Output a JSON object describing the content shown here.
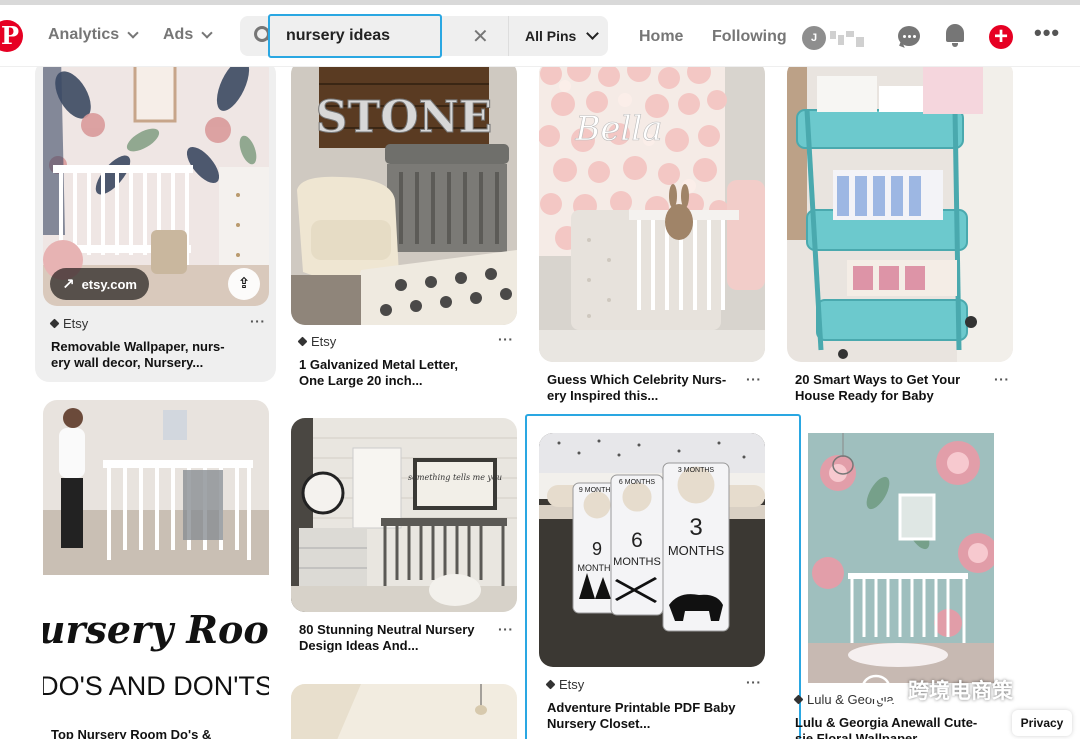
{
  "header": {
    "logo_letter": "P",
    "analytics_label": "Analytics",
    "ads_label": "Ads",
    "search": {
      "value": "nursery ideas",
      "placeholder": "Search"
    },
    "scope_label": "All Pins",
    "home_label": "Home",
    "following_label": "Following",
    "avatar_initial": "J",
    "brand_color": "#e60023"
  },
  "pins": [
    {
      "source": "Etsy",
      "title": "Removable Wallpaper, nurs-\nery wall decor, Nursery...",
      "chip": "etsy.com"
    },
    {
      "source": "Etsy",
      "title": "1 Galvanized Metal Letter,\nOne Large 20 inch...",
      "sign_text": "STONE"
    },
    {
      "title": "Guess Which Celebrity Nurs-\nery Inspired this...",
      "sign_text": "Bella"
    },
    {
      "title": "20 Smart Ways to Get Your\nHouse Ready for Baby"
    },
    {
      "title": "Top Nursery Room Do's &",
      "overlay_line1": "Nursery Room",
      "overlay_line2": "DO'S AND DON'TS"
    },
    {
      "title": "80 Stunning Neutral Nursery\nDesign Ideas And...",
      "sign_text": "something tells me you're going to love you forever"
    },
    {
      "source": "Etsy",
      "title": "Adventure Printable PDF Baby\nNursery Closet...",
      "dividers": [
        {
          "number": "9",
          "unit": "MONTHS",
          "top": "9 MONTHS"
        },
        {
          "number": "6",
          "unit": "MONTHS",
          "top": "6 MONTHS"
        },
        {
          "number": "3",
          "unit": "MONTHS",
          "top": "3 MONTHS"
        }
      ]
    },
    {
      "source": "Lulu & Georgia",
      "title": "Lulu & Georgia Anewall Cute-\nsie Floral Wallpaper"
    }
  ],
  "watermark": "跨境电商策",
  "privacy_label": "Privacy"
}
